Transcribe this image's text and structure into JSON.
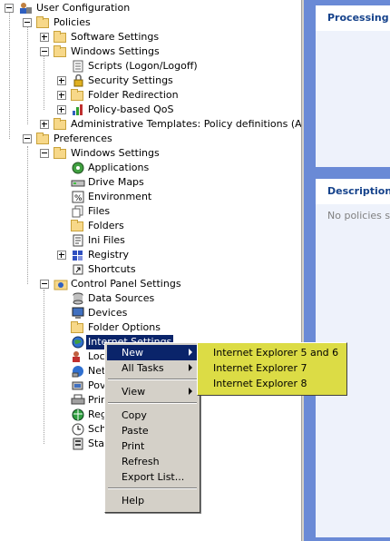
{
  "tree": {
    "user_configuration": "User Configuration",
    "policies": "Policies",
    "software_settings": "Software Settings",
    "windows_settings": "Windows Settings",
    "scripts": "Scripts (Logon/Logoff)",
    "security_settings": "Security Settings",
    "folder_redirection": "Folder Redirection",
    "policy_qos": "Policy-based QoS",
    "admin_templates": "Administrative Templates: Policy definitions (ADMX fil",
    "preferences": "Preferences",
    "pref_windows_settings": "Windows Settings",
    "applications": "Applications",
    "drive_maps": "Drive Maps",
    "environment": "Environment",
    "files": "Files",
    "folders": "Folders",
    "ini_files": "Ini Files",
    "registry": "Registry",
    "shortcuts": "Shortcuts",
    "control_panel": "Control Panel Settings",
    "data_sources": "Data Sources",
    "devices": "Devices",
    "folder_options": "Folder Options",
    "internet_settings": "Internet Settings",
    "local": "Loc",
    "network": "Net",
    "power": "Pov",
    "printers": "Prin",
    "regional": "Reg",
    "scheduled": "Sch",
    "start": "Sta"
  },
  "right_pane": {
    "processing_title": "Processing",
    "description_title": "Description",
    "description_text": "No policies sele"
  },
  "context_menu": {
    "new": "New",
    "all_tasks": "All Tasks",
    "view": "View",
    "copy": "Copy",
    "paste": "Paste",
    "print": "Print",
    "refresh": "Refresh",
    "export_list": "Export List...",
    "help": "Help"
  },
  "submenu": {
    "ie56": "Internet Explorer 5 and 6",
    "ie7": "Internet Explorer 7",
    "ie8": "Internet Explorer 8"
  },
  "colors": {
    "selection": "#0a246a",
    "submenu_bg": "#dcdc45",
    "right_pane_bg": "#6a8ad6",
    "menu_bg": "#d4d0c8"
  }
}
